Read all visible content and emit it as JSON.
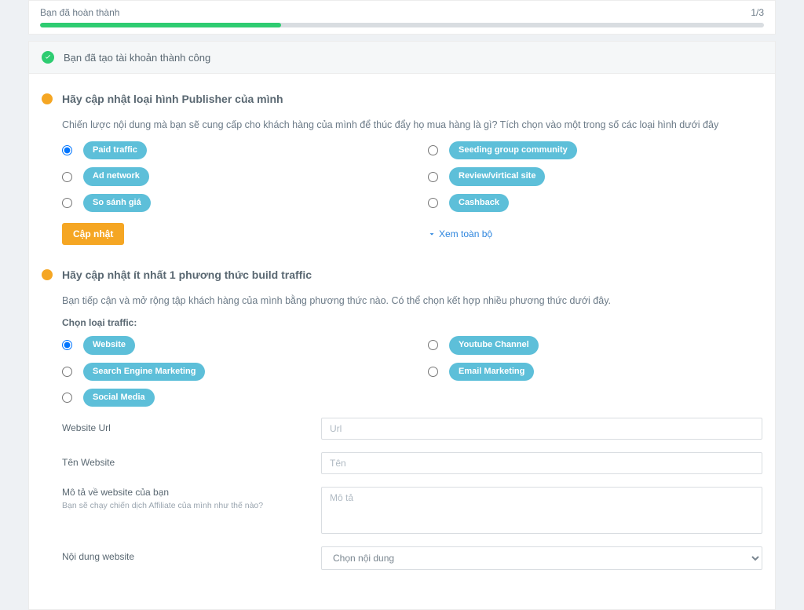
{
  "progress": {
    "label": "Bạn đã hoàn thành",
    "count": "1/3"
  },
  "success_message": "Bạn đã tạo tài khoản thành công",
  "publisher_section": {
    "title": "Hãy cập nhật loại hình Publisher của mình",
    "desc": "Chiến lược nội dung mà bạn sẽ cung cấp cho khách hàng của mình để thúc đẩy họ mua hàng là gì? Tích chọn vào một trong số các loại hình dưới đây",
    "options_left": [
      "Paid traffic",
      "Ad network",
      "So sánh giá"
    ],
    "options_right": [
      "Seeding group community",
      "Review/virtical site",
      "Cashback"
    ],
    "update_btn": "Cập nhật",
    "more_link": "Xem toàn bộ"
  },
  "traffic_section": {
    "title": "Hãy cập nhật ít nhất 1 phương thức build traffic",
    "desc": "Bạn tiếp cận và mở rộng tập khách hàng của mình bằng phương thức nào. Có thể chọn kết hợp nhiều phương thức dưới đây.",
    "subhead": "Chọn loại traffic:",
    "options_left": [
      "Website",
      "Search Engine Marketing",
      "Social Media"
    ],
    "options_right": [
      "Youtube Channel",
      "Email Marketing"
    ]
  },
  "form": {
    "url_label": "Website Url",
    "url_placeholder": "Url",
    "name_label": "Tên Website",
    "name_placeholder": "Tên",
    "desc_label": "Mô tả về website của bạn",
    "desc_sublabel": "Bạn sẽ chạy chiến dịch Affiliate của mình như thế nào?",
    "desc_placeholder": "Mô tả",
    "content_label": "Nội dung website",
    "content_placeholder": "Chọn nội dung"
  }
}
